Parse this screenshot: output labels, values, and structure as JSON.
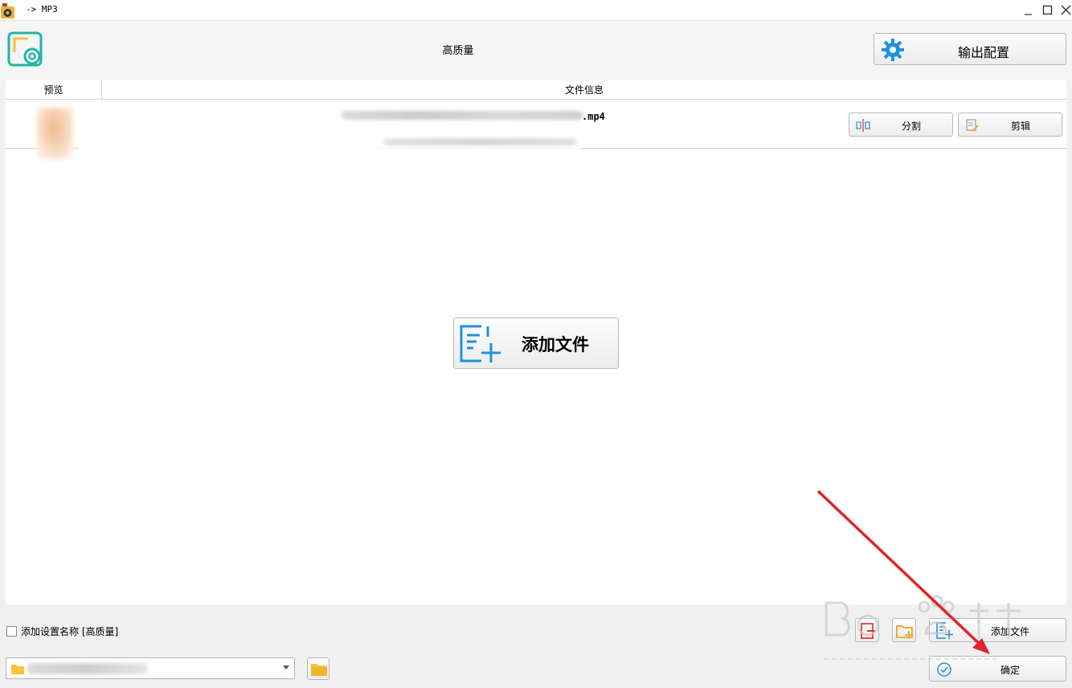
{
  "window": {
    "title": "-> MP3",
    "icons": [
      "app-icon",
      "minimize-icon",
      "maximize-icon",
      "close-icon"
    ]
  },
  "header": {
    "preset_name": "高质量",
    "output_config_label": "输出配置"
  },
  "table": {
    "columns": [
      "预览",
      "文件信息"
    ],
    "rows": [
      {
        "file_ext": ".mp4",
        "split_label": "分割",
        "edit_label": "剪辑"
      }
    ]
  },
  "main": {
    "add_file_label": "添加文件"
  },
  "footer": {
    "add_setting_name_label": "添加设置名称 [高质量]",
    "add_setting_name_checked": false,
    "add_file_label": "添加文件",
    "ok_label": "确定"
  },
  "colors": {
    "accent_blue": "#1f93d9",
    "logo_teal": "#1fb5a6",
    "logo_yellow": "#f2c230",
    "annotation_red": "#e0242a"
  }
}
